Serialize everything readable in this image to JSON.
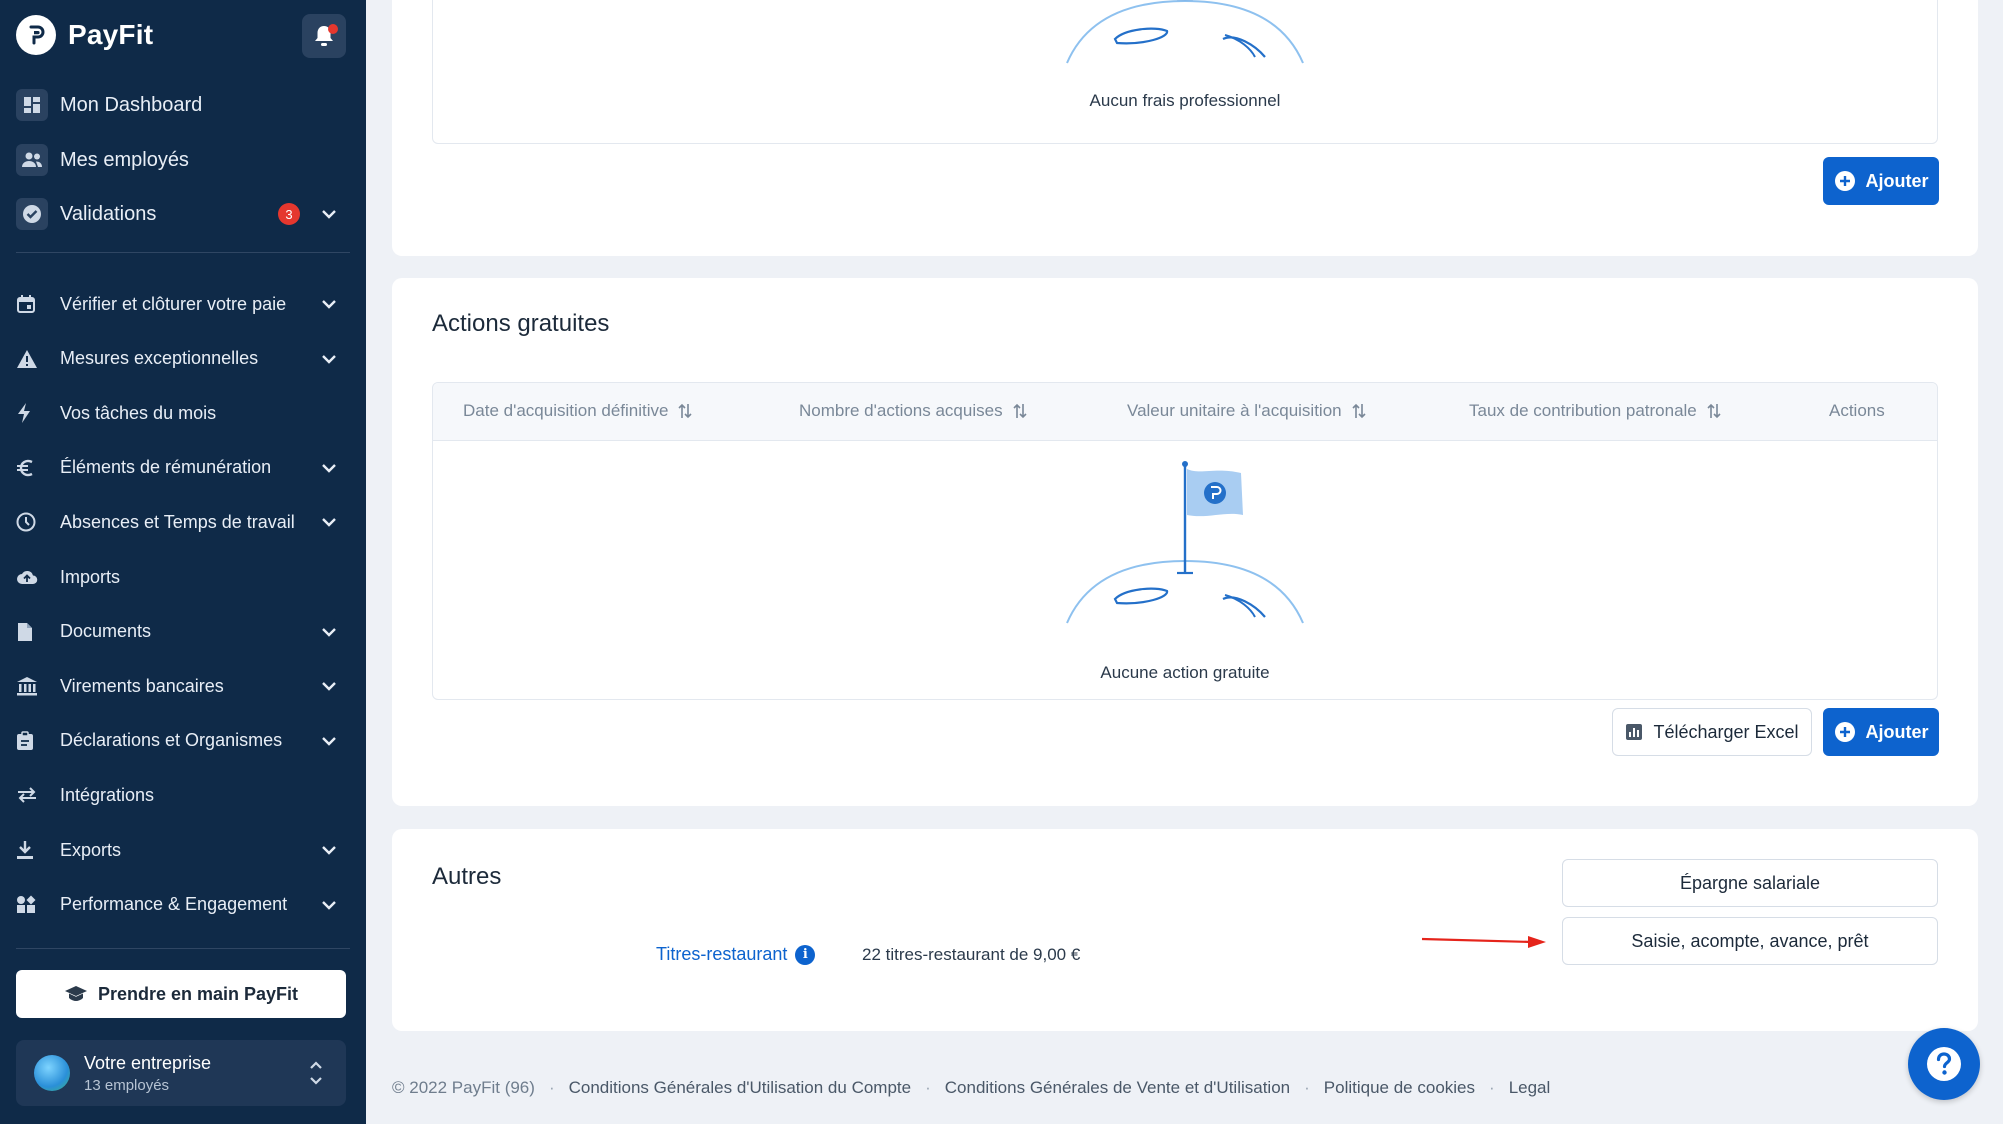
{
  "brand": {
    "name": "PayFit"
  },
  "nav_top": [
    {
      "label": "Mon Dashboard",
      "icon": "dashboard-icon"
    },
    {
      "label": "Mes employés",
      "icon": "people-icon"
    },
    {
      "label": "Validations",
      "icon": "check-circle-icon",
      "badge": "3"
    }
  ],
  "nav": [
    {
      "label": "Vérifier et clôturer votre paie",
      "icon": "calendar-icon",
      "chevron": true
    },
    {
      "label": "Mesures exceptionnelles",
      "icon": "warning-icon",
      "chevron": true
    },
    {
      "label": "Vos tâches du mois",
      "icon": "bolt-icon",
      "chevron": false
    },
    {
      "label": "Éléments de rémunération",
      "icon": "euro-icon",
      "chevron": true
    },
    {
      "label": "Absences et Temps de travail",
      "icon": "clock-icon",
      "chevron": true
    },
    {
      "label": "Imports",
      "icon": "cloud-upload-icon",
      "chevron": false
    },
    {
      "label": "Documents",
      "icon": "document-icon",
      "chevron": true
    },
    {
      "label": "Virements bancaires",
      "icon": "bank-icon",
      "chevron": true
    },
    {
      "label": "Déclarations et Organismes",
      "icon": "clipboard-icon",
      "chevron": true
    },
    {
      "label": "Intégrations",
      "icon": "swap-icon",
      "chevron": false
    },
    {
      "label": "Exports",
      "icon": "download-icon",
      "chevron": true
    },
    {
      "label": "Performance & Engagement",
      "icon": "widgets-icon",
      "chevron": true
    }
  ],
  "sidebar_cta": {
    "label": "Prendre en main PayFit"
  },
  "company": {
    "name": "Votre entreprise",
    "employees": "13 employés"
  },
  "frais": {
    "empty_label": "Aucun frais professionnel",
    "add_label": "Ajouter"
  },
  "actions": {
    "title": "Actions gratuites",
    "columns": [
      "Date d'acquisition définitive",
      "Nombre d'actions acquises",
      "Valeur unitaire à l'acquisition",
      "Taux de contribution patronale",
      "Actions"
    ],
    "empty_label": "Aucune action gratuite",
    "excel_label": "Télécharger Excel",
    "add_label": "Ajouter"
  },
  "autres": {
    "title": "Autres",
    "link_label": "Titres-restaurant",
    "value": "22 titres-restaurant de 9,00 €",
    "buttons": [
      "Épargne salariale",
      "Saisie, acompte, avance, prêt"
    ]
  },
  "footer": {
    "copyright": "© 2022 PayFit (96)",
    "links": [
      "Conditions Générales d'Utilisation du Compte",
      "Conditions Générales de Vente et d'Utilisation",
      "Politique de cookies",
      "Legal"
    ]
  },
  "colors": {
    "sidebar": "#0f2a48",
    "primary": "#0d63ce",
    "badge": "#e5372e",
    "annotation_arrow": "#e5241b"
  }
}
